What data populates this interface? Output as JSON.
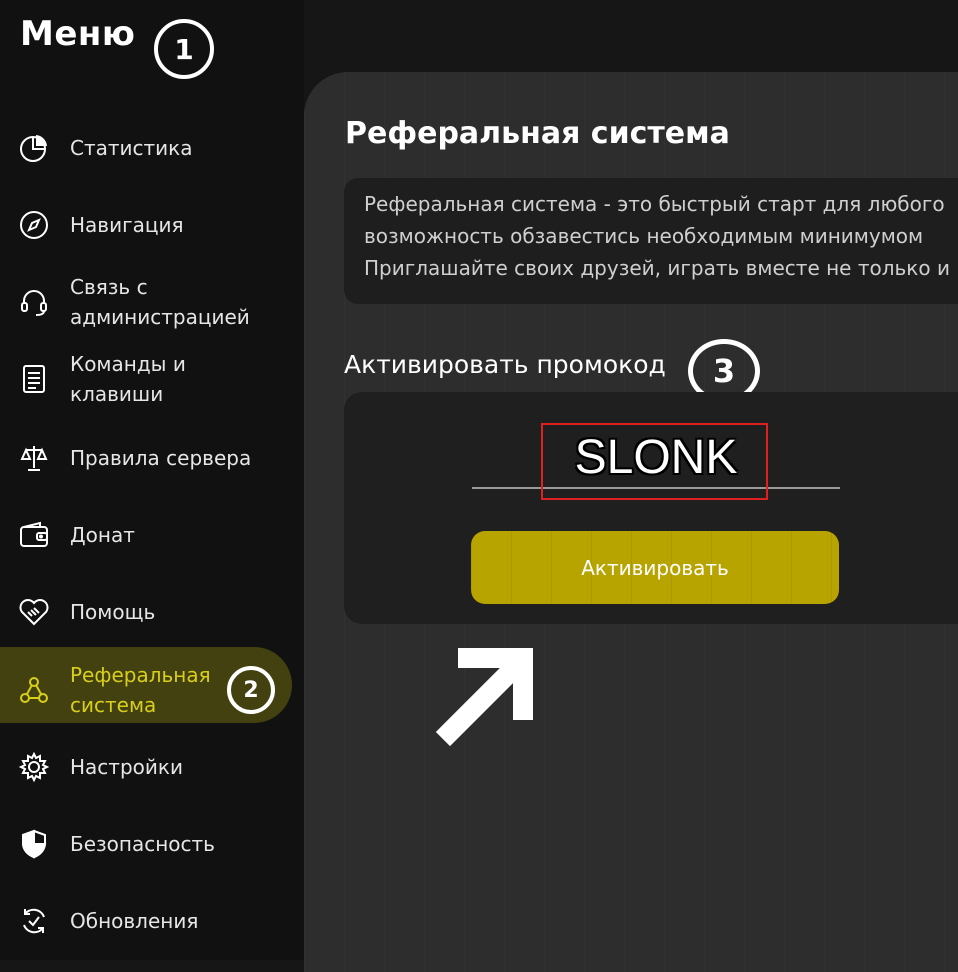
{
  "sidebar": {
    "title": "Меню",
    "badge": "1",
    "items": [
      {
        "label": "Статистика",
        "icon": "pie-chart-icon"
      },
      {
        "label": "Навигация",
        "icon": "compass-icon"
      },
      {
        "label": "Связь с\nадминистрацией",
        "icon": "headset-icon"
      },
      {
        "label": "Команды и\nклавиши",
        "icon": "document-icon"
      },
      {
        "label": "Правила сервера",
        "icon": "scales-icon"
      },
      {
        "label": "Донат",
        "icon": "wallet-icon"
      },
      {
        "label": "Помощь",
        "icon": "handshake-heart-icon"
      },
      {
        "label": "Реферальная\nсистема",
        "icon": "referral-network-icon",
        "active": true
      },
      {
        "label": "Настройки",
        "icon": "gear-icon"
      },
      {
        "label": "Безопасность",
        "icon": "shield-icon"
      },
      {
        "label": "Обновления",
        "icon": "refresh-check-icon"
      }
    ],
    "active_badge": "2"
  },
  "main": {
    "title": "Реферальная система",
    "description_lines": [
      "Реферальная система - это быстрый старт для любого",
      "возможность обзавестись необходимым минимумом",
      "Приглашайте своих друзей, играть вместе не только и"
    ],
    "promo": {
      "label": "Активировать промокод",
      "badge": "3",
      "input_value": "SLONK",
      "button_label": "Активировать"
    }
  },
  "colors": {
    "accent": "#b7a400",
    "active_text": "#d8cf1a",
    "highlight": "#e02020",
    "background": "#161616",
    "panel": "#2d2d2d"
  }
}
